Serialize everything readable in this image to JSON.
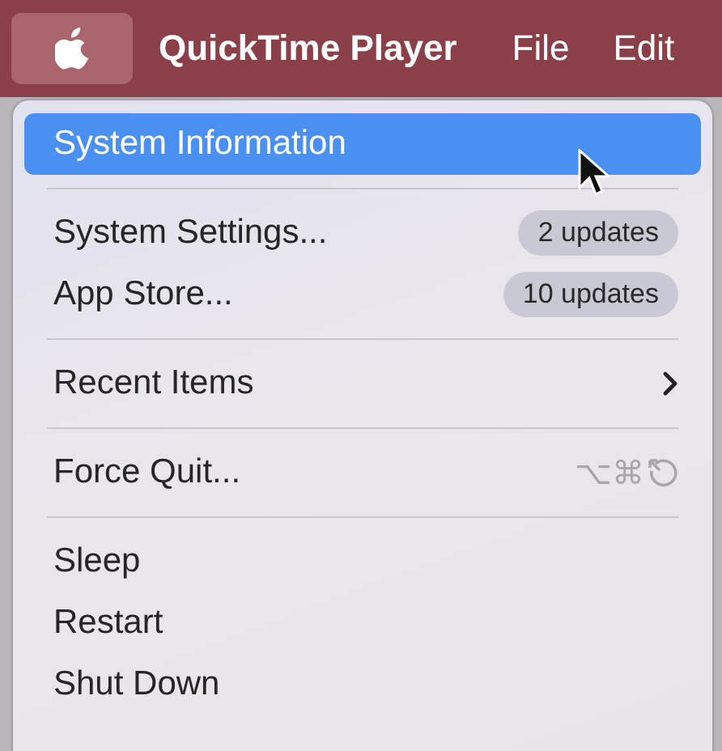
{
  "menu_bar": {
    "apple_menu": {
      "selected": true
    },
    "items": [
      {
        "label": "QuickTime Player",
        "bold": true
      },
      {
        "label": "File",
        "bold": false
      },
      {
        "label": "Edit",
        "bold": false
      }
    ]
  },
  "menu": {
    "groups": [
      [
        {
          "label": "System Information",
          "selected": true
        }
      ],
      [
        {
          "label": "System Settings...",
          "selected": false,
          "badge": "2 updates"
        },
        {
          "label": "App Store...",
          "selected": false,
          "badge": "10 updates"
        }
      ],
      [
        {
          "label": "Recent Items",
          "selected": false,
          "submenu": true
        }
      ],
      [
        {
          "label": "Force Quit...",
          "selected": false,
          "shortcut": "⌥⌘"
        }
      ],
      [
        {
          "label": "Sleep",
          "selected": false
        },
        {
          "label": "Restart",
          "selected": false
        },
        {
          "label": "Shut Down",
          "selected": false
        }
      ]
    ]
  }
}
